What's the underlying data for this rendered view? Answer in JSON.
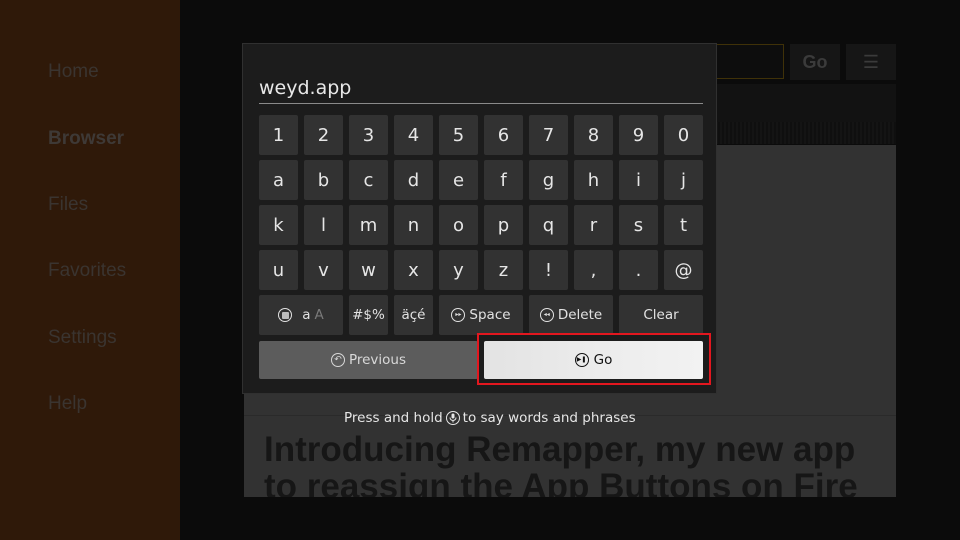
{
  "sidebar": {
    "items": [
      {
        "label": "Home",
        "active": false
      },
      {
        "label": "Browser",
        "active": true
      },
      {
        "label": "Files",
        "active": false
      },
      {
        "label": "Favorites",
        "active": false
      },
      {
        "label": "Settings",
        "active": false
      },
      {
        "label": "Help",
        "active": false
      }
    ],
    "background_color": "#2f1909"
  },
  "browser": {
    "go_label": "Go",
    "menu_icon": "hamburger-menu-icon",
    "headline": "Introducing Remapper, my new app to reassign the App Buttons on Fire"
  },
  "keyboard": {
    "input_value": "weyd.app",
    "rows": [
      [
        "1",
        "2",
        "3",
        "4",
        "5",
        "6",
        "7",
        "8",
        "9",
        "0"
      ],
      [
        "a",
        "b",
        "c",
        "d",
        "e",
        "f",
        "g",
        "h",
        "i",
        "j"
      ],
      [
        "k",
        "l",
        "m",
        "n",
        "o",
        "p",
        "q",
        "r",
        "s",
        "t"
      ],
      [
        "u",
        "v",
        "w",
        "x",
        "y",
        "z",
        "!",
        ",",
        ".",
        "@"
      ]
    ],
    "case_toggle": {
      "lower": "a",
      "upper": "A",
      "icon": "stop-button-icon"
    },
    "symbols_label": "#$%",
    "accents_label": "äçé",
    "space": {
      "label": "Space",
      "icon": "fast-forward-icon"
    },
    "delete": {
      "label": "Delete",
      "icon": "rewind-icon"
    },
    "clear_label": "Clear",
    "previous": {
      "label": "Previous",
      "icon": "back-icon"
    },
    "go": {
      "label": "Go",
      "icon": "play-pause-icon",
      "focused": true
    },
    "highlight_color": "#e3171f"
  },
  "voice_hint": {
    "before": "Press and hold",
    "icon": "microphone-icon",
    "after": "to say words and phrases"
  }
}
